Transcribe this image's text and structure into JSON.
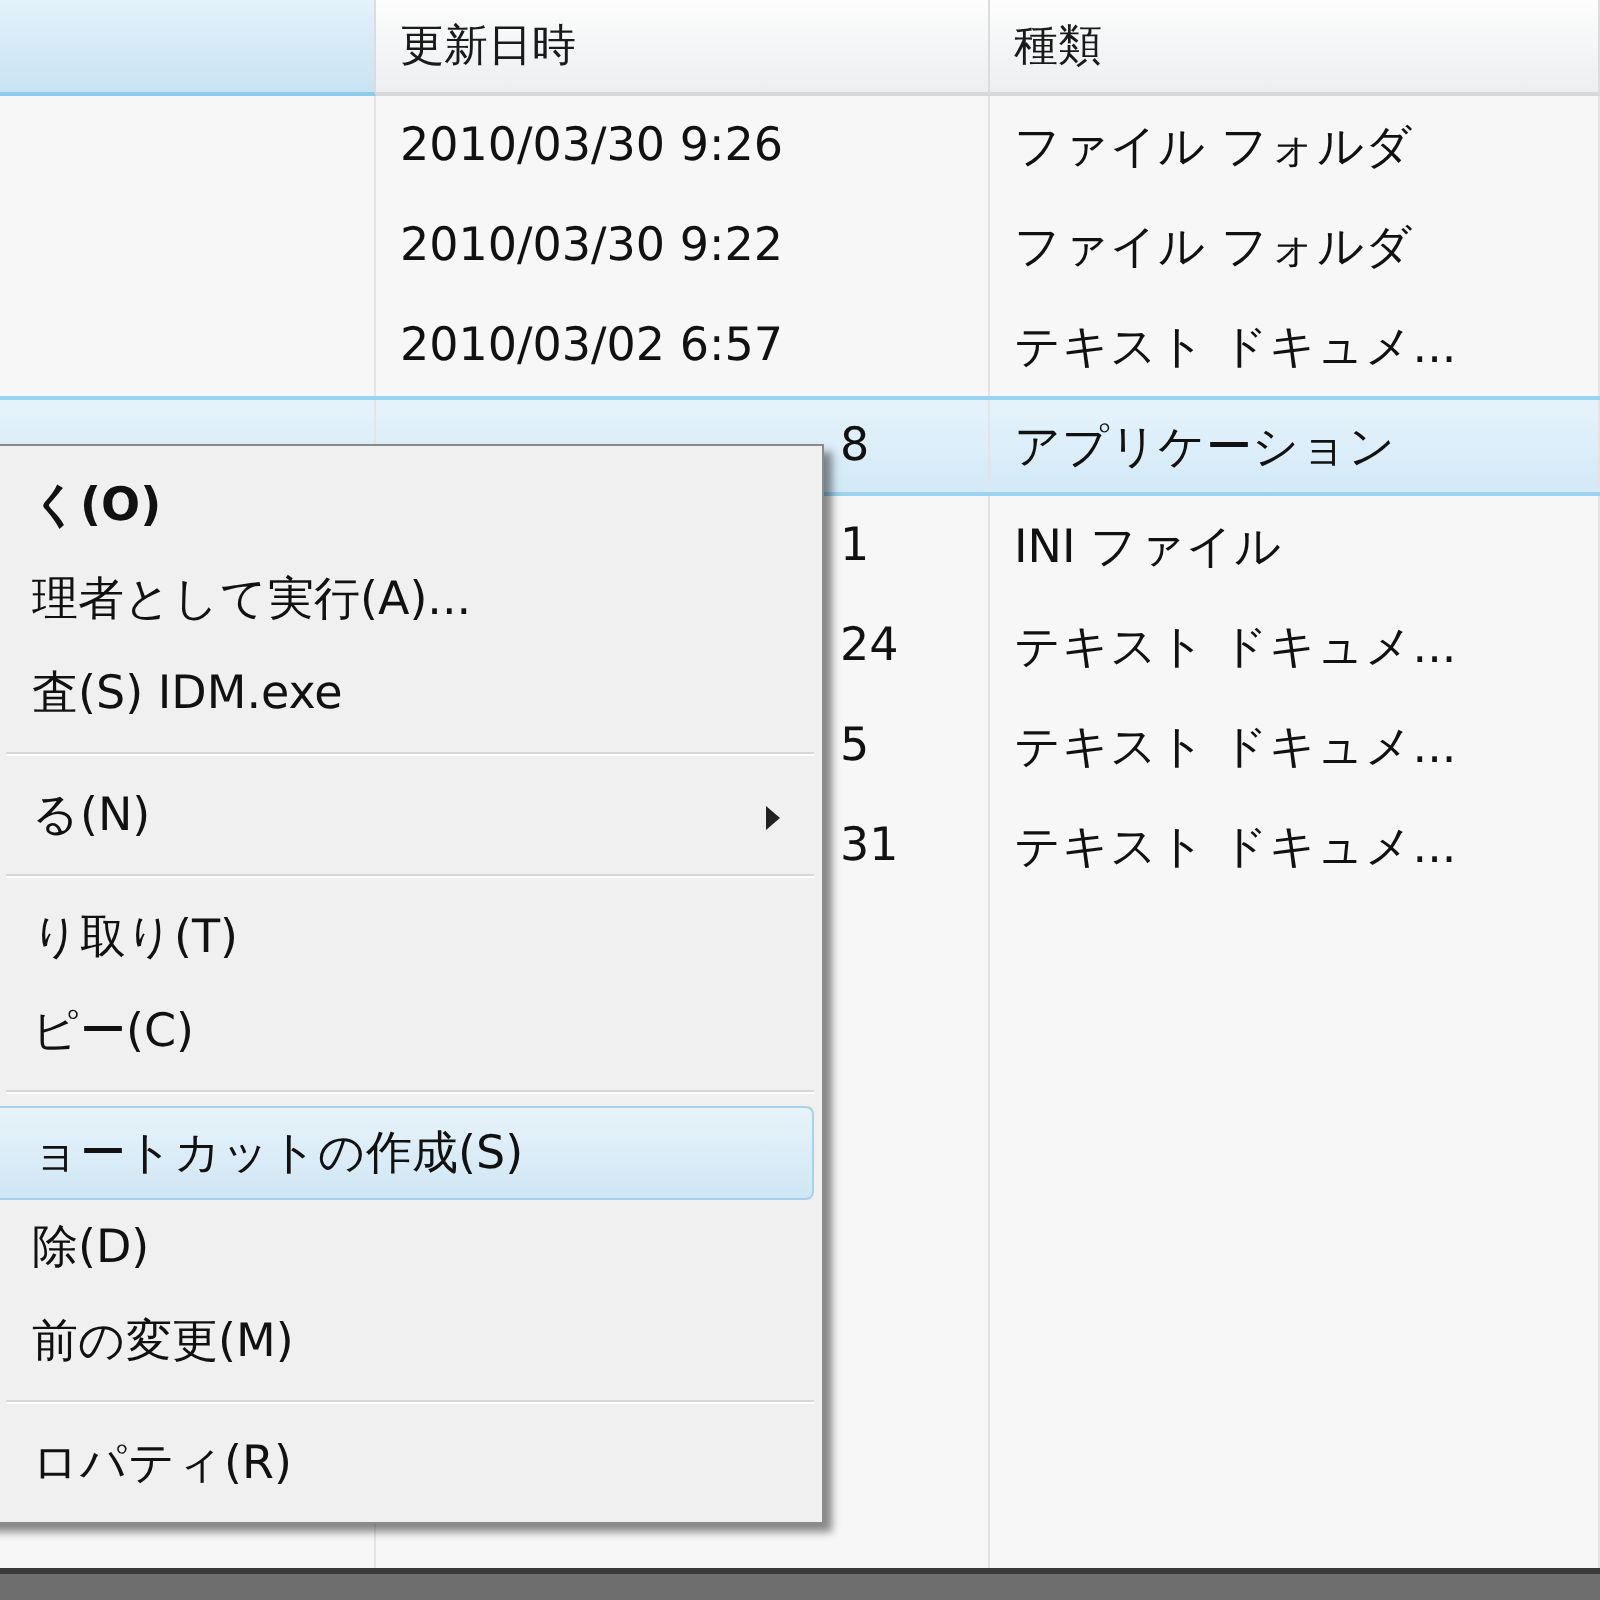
{
  "columns": [
    {
      "sorted": true
    },
    {
      "label": "更新日時",
      "sorted": false
    },
    {
      "label": "種類",
      "sorted": false
    }
  ],
  "rows": [
    {
      "date": "2010/03/30 9:26",
      "type": "ファイル フォルダ",
      "selected": false,
      "date_covered": false
    },
    {
      "date": "2010/03/30 9:22",
      "type": "ファイル フォルダ",
      "selected": false,
      "date_covered": false
    },
    {
      "date": "2010/03/02 6:57",
      "type": "テキスト ドキュメ...",
      "selected": false,
      "date_covered": false
    },
    {
      "date": "8",
      "type": "アプリケーション",
      "selected": true,
      "date_covered": true
    },
    {
      "date": "1",
      "type": "INI ファイル",
      "selected": false,
      "date_covered": true
    },
    {
      "date": "24",
      "type": "テキスト ドキュメ...",
      "selected": false,
      "date_covered": true
    },
    {
      "date": "5",
      "type": "テキスト ドキュメ...",
      "selected": false,
      "date_covered": true
    },
    {
      "date": "31",
      "type": "テキスト ドキュメ...",
      "selected": false,
      "date_covered": true
    }
  ],
  "context_menu": [
    {
      "kind": "item",
      "label": "く(O)",
      "bold": true,
      "selected": false,
      "has_submenu": false
    },
    {
      "kind": "item",
      "label": "理者として実行(A)...",
      "bold": false,
      "selected": false,
      "has_submenu": false
    },
    {
      "kind": "item",
      "label": "査(S) IDM.exe",
      "bold": false,
      "selected": false,
      "has_submenu": false
    },
    {
      "kind": "separator"
    },
    {
      "kind": "item",
      "label": "る(N)",
      "bold": false,
      "selected": false,
      "has_submenu": true
    },
    {
      "kind": "separator"
    },
    {
      "kind": "item",
      "label": "り取り(T)",
      "bold": false,
      "selected": false,
      "has_submenu": false
    },
    {
      "kind": "item",
      "label": "ピー(C)",
      "bold": false,
      "selected": false,
      "has_submenu": false
    },
    {
      "kind": "separator"
    },
    {
      "kind": "item",
      "label": "ョートカットの作成(S)",
      "bold": false,
      "selected": true,
      "has_submenu": false
    },
    {
      "kind": "item",
      "label": "除(D)",
      "bold": false,
      "selected": false,
      "has_submenu": false
    },
    {
      "kind": "item",
      "label": "前の変更(M)",
      "bold": false,
      "selected": false,
      "has_submenu": false
    },
    {
      "kind": "separator"
    },
    {
      "kind": "item",
      "label": "ロパティ(R)",
      "bold": false,
      "selected": false,
      "has_submenu": false
    }
  ]
}
